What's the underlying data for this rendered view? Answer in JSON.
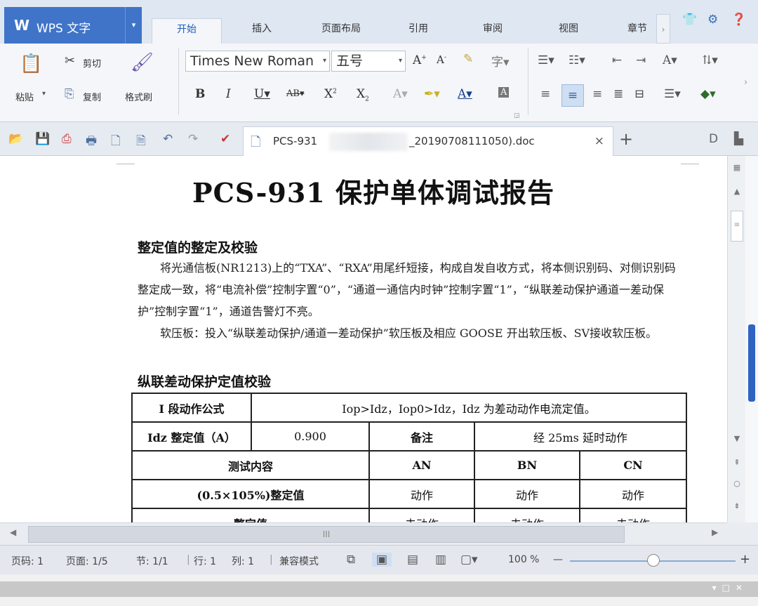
{
  "app": {
    "logo": "W",
    "name": "WPS 文字",
    "dropdown": "▾"
  },
  "menu_tabs": [
    {
      "label": "开始"
    },
    {
      "label": "插入"
    },
    {
      "label": "页面布局"
    },
    {
      "label": "引用"
    },
    {
      "label": "审阅"
    },
    {
      "label": "视图"
    },
    {
      "label": "章节"
    }
  ],
  "ribbon": {
    "paste_label": "粘贴",
    "cut_label": "剪切",
    "copy_label": "复制",
    "format_painter_label": "格式刷",
    "font_name": "Times New Roman",
    "font_size": "五号"
  },
  "document_tab": {
    "filename_start": "PCS-931",
    "filename_end": "_20190708111050).doc",
    "close": "×",
    "new": "+"
  },
  "document": {
    "title": "PCS-931 保护单体调试报告",
    "section1_heading": "整定值的整定及校验",
    "para1": "将光通信板(NR1213)上的“TXA”、“RXA”用尾纤短接，构成自发自收方式，将本侧识别码、对侧识别码整定成一致，将“电流补偿”控制字置“0”，“通道一通信内时钟”控制字置“1”，“纵联差动保护通道一差动保护”控制字置“1”，通道告警灯不亮。",
    "para2": "软压板：投入“纵联差动保护/通道一差动保护”软压板及相应 GOOSE 开出软压板、SV接收软压板。",
    "section2_heading": "纵联差动保护定值校验",
    "table": {
      "r1_label": "I 段动作公式",
      "r1_value": "Iop>Idz，Iop0>Idz，Idz 为差动动作电流定值。",
      "r2_label": "Idz 整定值（A）",
      "r2_value": "0.900",
      "r2_note_label": "备注",
      "r2_note_value": "经 25ms 延时动作",
      "r3_label": "测试内容",
      "r3_an": "AN",
      "r3_bn": "BN",
      "r3_cn": "CN",
      "r4_label": "(0.5×105%)整定值",
      "r4_an": "动作",
      "r4_bn": "动作",
      "r4_cn": "动作",
      "r5_label": "整定值",
      "r5_an": "未动作",
      "r5_bn": "未动作",
      "r5_cn": "未动作"
    }
  },
  "statusbar": {
    "page_num": "页码: 1",
    "page_count": "页面: 1/5",
    "section": "节: 1/1",
    "row": "行: 1",
    "col": "列: 1",
    "mode": "兼容模式",
    "zoom": "100 %",
    "zoom_minus": "—",
    "zoom_plus": "+"
  },
  "hscroll_grip": "III"
}
